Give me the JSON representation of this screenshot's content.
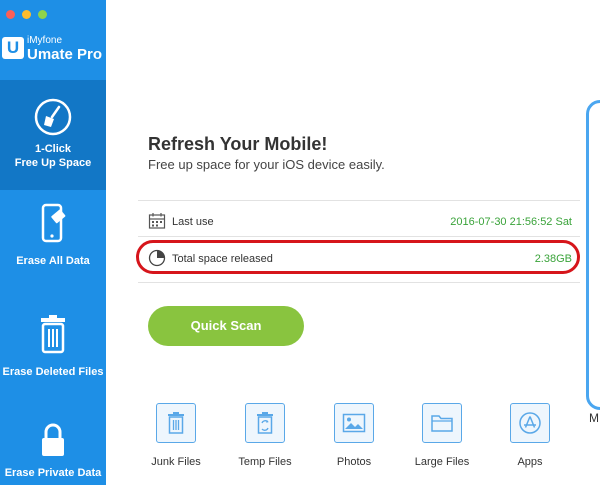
{
  "window": {
    "controls": [
      "close",
      "minimize",
      "maximize"
    ]
  },
  "app": {
    "brand_small": "iMyfone",
    "brand_big": "Umate Pro",
    "logo_letter": "U"
  },
  "sidebar": {
    "items": [
      {
        "label_line1": "1-Click",
        "label_line2": "Free Up Space",
        "icon": "broom-icon",
        "active": true
      },
      {
        "label": "Erase All Data",
        "icon": "phone-erase-icon"
      },
      {
        "label": "Erase Deleted Files",
        "icon": "trash-icon"
      },
      {
        "label": "Erase Private Data",
        "icon": "lock-icon"
      }
    ]
  },
  "main": {
    "title": "Refresh Your Mobile!",
    "subtitle": "Free up space for your iOS device easily.",
    "last_use": {
      "label": "Last use",
      "value": "2016-07-30 21:56:52 Sat",
      "icon": "calendar-icon"
    },
    "space_released": {
      "label": "Total space released",
      "value": "2.38GB",
      "icon": "pie-icon"
    },
    "scan_button": "Quick Scan",
    "categories": [
      {
        "label": "Junk Files",
        "icon": "trash-icon"
      },
      {
        "label": "Temp Files",
        "icon": "recycle-icon"
      },
      {
        "label": "Photos",
        "icon": "image-icon"
      },
      {
        "label": "Large Files",
        "icon": "folder-icon"
      },
      {
        "label": "Apps",
        "icon": "app-store-icon"
      }
    ],
    "side_fragment": "M"
  },
  "colors": {
    "sidebar": "#1e8fe6",
    "sidebar_active": "#1277c6",
    "accent_green": "#89c43f",
    "value_green": "#3aa33a",
    "highlight_red": "#d6151b",
    "icon_blue": "#5aa8e8"
  }
}
